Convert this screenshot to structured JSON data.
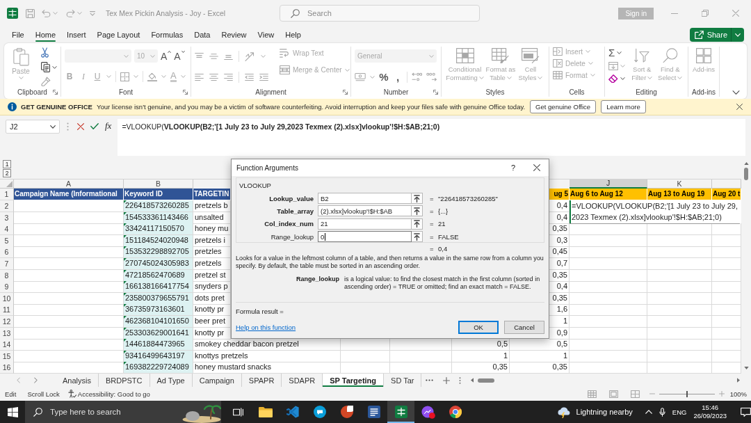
{
  "title_bar": {
    "title": "Tex Mex Pickin Analysis - Joy - Excel",
    "search": {
      "placeholder": "Search"
    },
    "sign_in": "Sign in"
  },
  "menu_tabs": [
    {
      "label": "File",
      "selected": false
    },
    {
      "label": "Home",
      "selected": true
    },
    {
      "label": "Insert",
      "selected": false
    },
    {
      "label": "Page Layout",
      "selected": false
    },
    {
      "label": "Formulas",
      "selected": false
    },
    {
      "label": "Data",
      "selected": false
    },
    {
      "label": "Review",
      "selected": false
    },
    {
      "label": "View",
      "selected": false
    },
    {
      "label": "Help",
      "selected": false
    }
  ],
  "share_button": "Share",
  "ribbon": {
    "clipboard": {
      "label": "Clipboard",
      "launcher": true,
      "paste": {
        "label": "Paste",
        "disabled": true
      }
    },
    "font": {
      "label": "Font",
      "launcher": true,
      "font_name": {
        "disabled": true
      },
      "font_size": {
        "value": "10",
        "disabled": true
      },
      "size_buttons": [
        {
          "label": "A",
          "disabled": false
        },
        {
          "label": "A",
          "disabled": false
        }
      ],
      "style_buttons": [
        {
          "label": "B",
          "disabled": true
        },
        {
          "label": "I",
          "disabled": true
        },
        {
          "label": "U",
          "disabled": true
        }
      ],
      "font_color": {
        "label": "A",
        "disabled": true
      }
    },
    "alignment": {
      "label": "Alignment",
      "launcher": true,
      "wrap_text": {
        "label": "Wrap Text",
        "disabled": true
      },
      "merge": {
        "label": "Merge & Center",
        "disabled": true
      }
    },
    "number": {
      "label": "Number",
      "launcher": true,
      "format": {
        "value": "General",
        "disabled": true
      },
      "glyph_buttons": [
        {
          "label": "%",
          "disabled": false
        },
        {
          "label": ",",
          "disabled": false
        }
      ]
    },
    "styles": {
      "label": "Styles",
      "launcher": false,
      "commands": [
        {
          "label": "Conditional Formatting",
          "disabled": true
        },
        {
          "label": "Format as Table",
          "disabled": true
        },
        {
          "label": "Cell Styles",
          "disabled": true
        }
      ]
    },
    "cells": {
      "label": "Cells",
      "launcher": false,
      "commands": [
        {
          "label": "Insert",
          "disabled": true
        },
        {
          "label": "Delete",
          "disabled": true
        },
        {
          "label": "Format",
          "disabled": true
        }
      ]
    },
    "editing": {
      "label": "Editing",
      "launcher": false,
      "autosum": {
        "label": "Σ",
        "disabled": false
      },
      "commands": [
        {
          "label": "Sort & Filter",
          "disabled": true
        },
        {
          "label": "Find & Select",
          "disabled": true
        }
      ]
    },
    "add_ins": {
      "label": "Add-ins",
      "launcher": false,
      "command": {
        "label": "Add-ins",
        "disabled": true
      }
    }
  },
  "info_bar": {
    "title": "GET GENUINE OFFICE",
    "message": "Your license isn't genuine, and you may be a victim of software counterfeiting. Avoid interruption and keep your files safe with genuine Office today.",
    "buttons": [
      "Get genuine Office",
      "Learn more"
    ]
  },
  "formula_bar": {
    "name_box": "J2",
    "function_button": "fx",
    "formula": "=VLOOKUP(**VLOOKUP(B2;'[1 July 23 to July 29,2023 Texmex (2).xlsx]vlookup'!$H:$AB;21;0)**"
  },
  "sheet": {
    "outline_levels": [
      "1",
      "2"
    ],
    "column_headers": [
      {
        "label": "A",
        "selected": false
      },
      {
        "label": "B",
        "selected": false
      },
      {
        "label": "J",
        "selected": true
      },
      {
        "label": "K",
        "selected": false
      }
    ],
    "header_row": {
      "number": "1",
      "cells": [
        {
          "text": "Campaign Name (Informational",
          "color": "#305496"
        },
        {
          "text": "Keyword ID",
          "color": "#305496"
        },
        {
          "text": "TARGETIN",
          "color": "#305496"
        },
        {
          "text": "ug 5",
          "color": "#ffc000"
        },
        {
          "text": "Aug 6 to Aug 12",
          "color": "#ffc000"
        },
        {
          "text": "Aug 13 to Aug 19",
          "color": "#ffc000"
        },
        {
          "text": "Aug 20 t",
          "color": "#ffc000"
        }
      ]
    },
    "rows": [
      {
        "number": "2",
        "keyword_id": "226418573260285",
        "targeting": "pretzels b",
        "column_8": "0,4"
      },
      {
        "number": "3",
        "keyword_id": "154533361143466",
        "targeting": "unsalted",
        "column_8": "0,4"
      },
      {
        "number": "4",
        "keyword_id": "33424117150570",
        "targeting": "honey mu",
        "column_8": "0,35"
      },
      {
        "number": "5",
        "keyword_id": "151184524020948",
        "targeting": "pretzels i",
        "column_8": "0,3"
      },
      {
        "number": "6",
        "keyword_id": "153532298892705",
        "targeting": "pretzles",
        "column_8": "0,45"
      },
      {
        "number": "7",
        "keyword_id": "270745024305983",
        "targeting": "pretzels",
        "column_8": "0,7"
      },
      {
        "number": "8",
        "keyword_id": "47218562470689",
        "targeting": "pretzel st",
        "column_8": "0,35"
      },
      {
        "number": "9",
        "keyword_id": "166138166417754",
        "targeting": "snyders p",
        "column_8": "0,4"
      },
      {
        "number": "10",
        "keyword_id": "235800379655791",
        "targeting": "dots pret",
        "column_8": "0,35"
      },
      {
        "number": "11",
        "keyword_id": "36735973163601",
        "targeting": "knotty pr",
        "column_8": "1,6"
      },
      {
        "number": "12",
        "keyword_id": "462368104101650",
        "targeting": "beer pret",
        "column_8": "1"
      },
      {
        "number": "13",
        "keyword_id": "253303629001641",
        "targeting": "knotty pr",
        "column_8": "0,9"
      },
      {
        "number": "14",
        "keyword_id": "14461884473965",
        "targeting": "smokey cheddar bacon pretzel",
        "column_7": "0,5",
        "column_8": "0,5"
      },
      {
        "number": "15",
        "keyword_id": "93416499643197",
        "targeting": "knottys pretzels",
        "column_7": "1",
        "column_8": "1"
      },
      {
        "number": "16",
        "keyword_id": "169382229724089",
        "targeting": "honey mustard snacks",
        "column_7": "0,35",
        "column_8": "0,35"
      }
    ],
    "cell_editor": {
      "lines": [
        "=VLOOKUP(VLOOKUP(B2;'[1 July 23 to July 29,",
        "2023 Texmex (2).xlsx]vlookup'!$H:$AB;21;0)"
      ]
    }
  },
  "dialog": {
    "title": "Function Arguments",
    "help_button": "?",
    "function_name": "VLOOKUP",
    "arguments": [
      {
        "label": "Lookup_value",
        "required": true,
        "value": "B2",
        "focused": false,
        "sign": "=",
        "result": "\"226418573260285\""
      },
      {
        "label": "Table_array",
        "required": true,
        "value": "(2).xlsx]vlookup'!$H:$AB",
        "focused": false,
        "sign": "=",
        "result": "{...}"
      },
      {
        "label": "Col_index_num",
        "required": true,
        "value": "21",
        "focused": false,
        "sign": "=",
        "result": "21"
      },
      {
        "label": "Range_lookup",
        "required": false,
        "value": "0",
        "focused": true,
        "sign": "=",
        "result": "FALSE"
      }
    ],
    "result": {
      "sign": "=",
      "value": "0,4"
    },
    "description": "Looks for a value in the leftmost column of a table, and then returns a value in the same row from a column you specify. By default, the table must be sorted in an ascending order.",
    "argument_help": {
      "label": "Range_lookup",
      "text": "is a logical value: to find the closest match in the first column (sorted in ascending order) = TRUE or omitted; find an exact match = FALSE."
    },
    "formula_result": "Formula result =",
    "help_link": "Help on this function",
    "buttons": [
      {
        "label": "OK",
        "default": true
      },
      {
        "label": "Cancel",
        "default": false
      }
    ]
  },
  "sheet_tabs": [
    {
      "label": "Analysis",
      "selected": false
    },
    {
      "label": "BRDPSTC",
      "selected": false
    },
    {
      "label": "Ad Type",
      "selected": false
    },
    {
      "label": "Campaign",
      "selected": false
    },
    {
      "label": "SPAPR",
      "selected": false
    },
    {
      "label": "SDAPR",
      "selected": false
    },
    {
      "label": "SP Targeting",
      "selected": true
    },
    {
      "label": "SD Tar",
      "selected": false
    }
  ],
  "status_bar": {
    "mode": "Edit",
    "scroll_lock": "Scroll Lock",
    "accessibility": "Accessibility: Good to go",
    "zoom_slider": {
      "level": 0.5
    },
    "zoom": "100%"
  },
  "taskbar": {
    "search": {
      "placeholder": "Type here to search"
    },
    "apps": [
      {
        "active": false
      },
      {
        "active": false
      },
      {
        "active": false
      },
      {
        "active": false
      },
      {
        "active": false
      },
      {
        "active": true
      },
      {
        "active": false
      },
      {
        "active": false
      }
    ],
    "weather": "Lightning nearby",
    "language": "ENG",
    "time": "15:46",
    "date": "26/09/2023"
  }
}
